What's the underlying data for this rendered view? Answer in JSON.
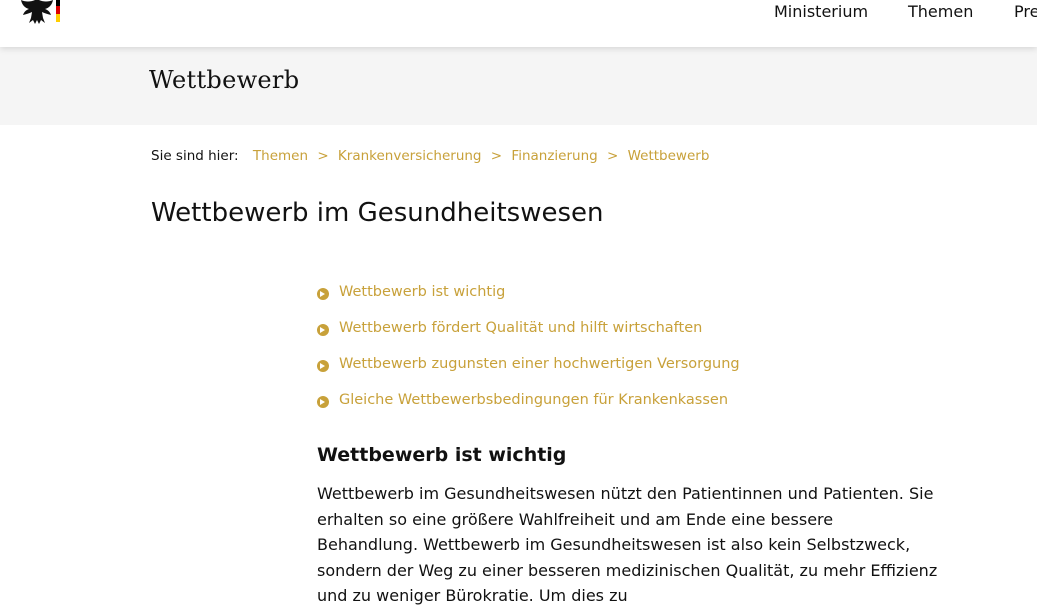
{
  "header": {
    "nav": [
      "Ministerium",
      "Themen",
      "Pre"
    ]
  },
  "banner": {
    "title": "Wettbewerb"
  },
  "breadcrumb": {
    "label": "Sie sind hier:",
    "items": [
      "Themen",
      "Krankenversicherung",
      "Finanzierung",
      "Wettbewerb"
    ],
    "separator": ">"
  },
  "page": {
    "title": "Wettbewerb im Gesundheitswesen",
    "toc": [
      "Wettbewerb ist wichtig",
      "Wettbewerb fördert Qualität und hilft wirtschaften",
      "Wettbewerb zugunsten einer hochwertigen Versorgung",
      "Gleiche Wettbewerbsbedingungen für Krankenkassen"
    ],
    "section": {
      "title": "Wettbewerb ist wichtig",
      "body": "Wettbewerb im Gesundheitswesen nützt den Patientinnen und Patienten. Sie erhalten so eine größere Wahlfreiheit und am Ende eine bessere Behandlung. Wettbewerb im Gesundheitswesen ist also kein Selbstzweck, sondern der Weg zu einer besseren medizinischen Qualität, zu mehr Effizienz und zu weniger Bürokratie. Um dies zu"
    }
  },
  "colors": {
    "accent": "#c8a13a",
    "banner_bg": "#f5f5f5",
    "text": "#111111"
  }
}
